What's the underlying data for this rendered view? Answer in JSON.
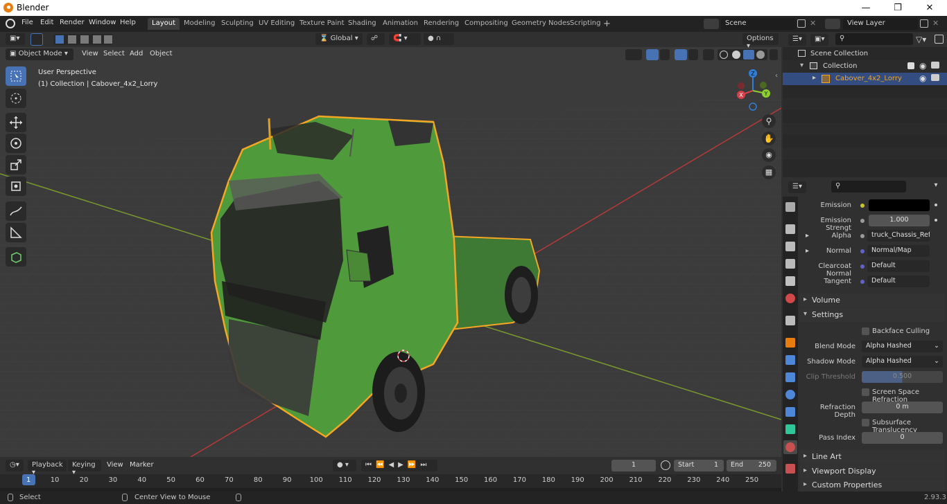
{
  "app": {
    "title": "Blender",
    "version": "2.93.3"
  },
  "menus": [
    "File",
    "Edit",
    "Render",
    "Window",
    "Help"
  ],
  "workspace_tabs": [
    {
      "label": "Layout",
      "active": true
    },
    {
      "label": "Modeling"
    },
    {
      "label": "Sculpting"
    },
    {
      "label": "UV Editing"
    },
    {
      "label": "Texture Paint"
    },
    {
      "label": "Shading"
    },
    {
      "label": "Animation"
    },
    {
      "label": "Rendering"
    },
    {
      "label": "Compositing"
    },
    {
      "label": "Geometry Nodes"
    },
    {
      "label": "Scripting"
    }
  ],
  "scene": {
    "name": "Scene",
    "view_layer": "View Layer"
  },
  "viewport": {
    "mode": "Object Mode",
    "header_menus": [
      "View",
      "Select",
      "Add",
      "Object"
    ],
    "transform_orientation": "Global",
    "options_label": "Options",
    "overlay_title": "User Perspective",
    "overlay_subtitle": "(1) Collection | Cabover_4x2_Lorry",
    "gizmo_axes": {
      "x": "X",
      "y": "Y",
      "z": "Z"
    }
  },
  "outliner": {
    "root": "Scene Collection",
    "collection": "Collection",
    "object": "Cabover_4x2_Lorry"
  },
  "properties": {
    "rows": [
      {
        "label": "Emission",
        "value": "",
        "type": "color"
      },
      {
        "label": "Emission Strengt",
        "value": "1.000",
        "type": "number"
      },
      {
        "label": "Alpha",
        "value": "truck_Chassis_Refra...",
        "type": "link"
      },
      {
        "label": "Normal",
        "value": "Normal/Map",
        "type": "link"
      },
      {
        "label": "Clearcoat Normal",
        "value": "Default",
        "type": "link"
      },
      {
        "label": "Tangent",
        "value": "Default",
        "type": "link"
      }
    ],
    "sections": {
      "volume": "Volume",
      "settings": "Settings",
      "line_art": "Line Art",
      "viewport_display": "Viewport Display",
      "custom_properties": "Custom Properties"
    },
    "settings": {
      "backface_culling": "Backface Culling",
      "blend_mode_label": "Blend Mode",
      "blend_mode_value": "Alpha Hashed",
      "shadow_mode_label": "Shadow Mode",
      "shadow_mode_value": "Alpha Hashed",
      "clip_threshold_label": "Clip Threshold",
      "clip_threshold_value": "0.500",
      "ssr_label": "Screen Space Refraction",
      "refraction_depth_label": "Refraction Depth",
      "refraction_depth_value": "0 m",
      "subsurface_label": "Subsurface Translucency",
      "pass_index_label": "Pass Index",
      "pass_index_value": "0"
    }
  },
  "timeline": {
    "menus": [
      "Playback",
      "Keying",
      "View",
      "Marker"
    ],
    "current_frame": "1",
    "start_label": "Start",
    "start_value": "1",
    "end_label": "End",
    "end_value": "250",
    "ticks": [
      "1",
      "10",
      "20",
      "30",
      "40",
      "50",
      "60",
      "70",
      "80",
      "90",
      "100",
      "110",
      "120",
      "130",
      "140",
      "150",
      "160",
      "170",
      "180",
      "190",
      "200",
      "210",
      "220",
      "230",
      "240",
      "250"
    ]
  },
  "statusbar": {
    "left": "Select",
    "middle": "Center View to Mouse",
    "version": "2.93.3"
  },
  "colors": {
    "accent": "#4772b3",
    "selection_outline": "#f5a623",
    "truck_green": "#4f9a3a",
    "x_axis": "#d9414a",
    "y_axis": "#8ccf2e",
    "z_axis": "#2f7fd9"
  }
}
